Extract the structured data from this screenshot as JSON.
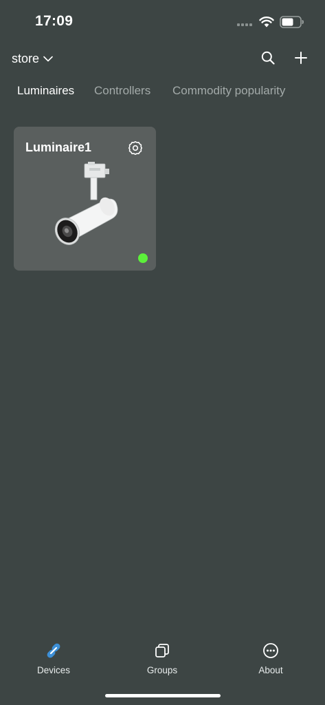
{
  "status_bar": {
    "time": "17:09"
  },
  "header": {
    "store_label": "store"
  },
  "tabs": [
    {
      "label": "Luminaires",
      "active": true
    },
    {
      "label": "Controllers",
      "active": false
    },
    {
      "label": "Commodity popularity",
      "active": false
    }
  ],
  "devices": [
    {
      "name": "Luminaire1",
      "online": true,
      "status_color": "#5cf03a"
    }
  ],
  "bottom_nav": [
    {
      "label": "Devices",
      "icon": "link-icon",
      "active": true
    },
    {
      "label": "Groups",
      "icon": "groups-icon",
      "active": false
    },
    {
      "label": "About",
      "icon": "more-circle-icon",
      "active": false
    }
  ],
  "colors": {
    "background": "#3d4544",
    "card": "#5a5f5e",
    "accent": "#3d8fd6"
  }
}
